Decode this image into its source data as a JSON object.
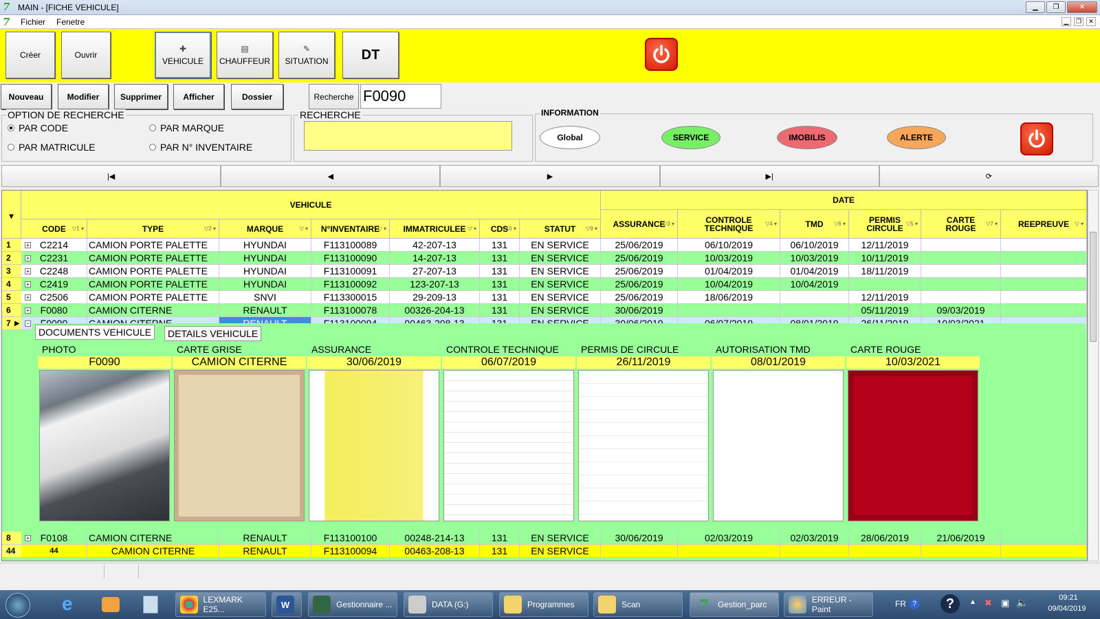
{
  "window": {
    "title": "MAIN - [FICHE VEHICULE]",
    "menu": [
      "Fichier",
      "Fenetre"
    ]
  },
  "toolbar": {
    "creer": "Créer",
    "ouvrir": "Ouvrir",
    "vehicule": "VEHICULE",
    "chauffeur": "CHAUFFEUR",
    "situation": "SITUATION",
    "dt": "DT"
  },
  "actions": {
    "nouveau": "Nouveau",
    "modifier": "Modifier",
    "supprimer": "Supprimer",
    "afficher": "Afficher",
    "dossier": "Dossier",
    "recherche": "Recherche",
    "search_value": "F0090"
  },
  "options": {
    "legend": "OPTION DE RECHERCHE",
    "par_code": "PAR CODE",
    "par_marque": "PAR MARQUE",
    "par_matricule": "PAR MATRICULE",
    "par_inventaire": "PAR N° INVENTAIRE",
    "selected": "PAR CODE"
  },
  "recherche": {
    "legend": "RECHERCHE"
  },
  "information": {
    "legend": "INFORMATION",
    "global": "Global",
    "service": "SERVICE",
    "imobilis": "IMOBILIS",
    "alerte": "ALERTE"
  },
  "colors": {
    "yellow": "#ffff00",
    "grid_green": "#99ff99",
    "header_yellow": "#ffff66",
    "service": "#77ee66",
    "imobilis": "#ee6a73",
    "alerte": "#f7a75a",
    "carte_rouge": "#b5001a"
  },
  "grid": {
    "group_vehicule": "VEHICULE",
    "group_date": "DATE",
    "columns": [
      "CODE",
      "TYPE",
      "MARQUE",
      "N°INVENTAIRE",
      "IMMATRICULEE",
      "CDS",
      "STATUT",
      "ASSURANCE",
      "CONTROLE TECHNIQUE",
      "TMD",
      "PERMIS CIRCULE",
      "CARTE ROUGE",
      "REEPREUVE"
    ],
    "filters": [
      "1",
      "2",
      "",
      "",
      "",
      "10",
      "9",
      "3",
      "4",
      "6",
      "5",
      "7",
      ""
    ],
    "rows": [
      {
        "n": "1",
        "code": "C2214",
        "type": "CAMION PORTE PALETTE",
        "marque": "HYUNDAI",
        "inv": "F113100089",
        "immat": "42-207-13",
        "cds": "131",
        "statut": "EN SERVICE",
        "ass": "25/06/2019",
        "ct": "06/10/2019",
        "tmd": "06/10/2019",
        "permis": "12/11/2019",
        "carte": "",
        "ree": ""
      },
      {
        "n": "2",
        "code": "C2231",
        "type": "CAMION PORTE PALETTE",
        "marque": "HYUNDAI",
        "inv": "F113100090",
        "immat": "14-207-13",
        "cds": "131",
        "statut": "EN SERVICE",
        "ass": "25/06/2019",
        "ct": "10/03/2019",
        "tmd": "10/03/2019",
        "permis": "10/11/2019",
        "carte": "",
        "ree": ""
      },
      {
        "n": "3",
        "code": "C2248",
        "type": "CAMION PORTE PALETTE",
        "marque": "HYUNDAI",
        "inv": "F113100091",
        "immat": "27-207-13",
        "cds": "131",
        "statut": "EN SERVICE",
        "ass": "25/06/2019",
        "ct": "01/04/2019",
        "tmd": "01/04/2019",
        "permis": "18/11/2019",
        "carte": "",
        "ree": ""
      },
      {
        "n": "4",
        "code": "C2419",
        "type": "CAMION PORTE PALETTE",
        "marque": "HYUNDAI",
        "inv": "F113100092",
        "immat": "123-207-13",
        "cds": "131",
        "statut": "EN SERVICE",
        "ass": "25/06/2019",
        "ct": "10/04/2019",
        "tmd": "10/04/2019",
        "permis": "",
        "carte": "",
        "ree": ""
      },
      {
        "n": "5",
        "code": "C2506",
        "type": "CAMION PORTE PALETTE",
        "marque": "SNVI",
        "inv": "F113300015",
        "immat": "29-209-13",
        "cds": "131",
        "statut": "EN SERVICE",
        "ass": "25/06/2019",
        "ct": "18/06/2019",
        "tmd": "",
        "permis": "12/11/2019",
        "carte": "",
        "ree": ""
      },
      {
        "n": "6",
        "code": "F0080",
        "type": "CAMION CITERNE",
        "marque": "RENAULT",
        "inv": "F113100078",
        "immat": "00326-204-13",
        "cds": "131",
        "statut": "EN SERVICE",
        "ass": "30/06/2019",
        "ct": "",
        "tmd": "",
        "permis": "05/11/2019",
        "carte": "09/03/2019",
        "ree": ""
      },
      {
        "n": "7",
        "code": "F0090",
        "type": "CAMION CITERNE",
        "marque": "RENAULT",
        "inv": "F113100094",
        "immat": "00463-208-13",
        "cds": "131",
        "statut": "EN SERVICE",
        "ass": "30/06/2019",
        "ct": "06/07/2019",
        "tmd": "08/01/2019",
        "permis": "26/11/2019",
        "carte": "10/03/2021",
        "ree": ""
      },
      {
        "n": "8",
        "code": "F0108",
        "type": "CAMION CITERNE",
        "marque": "RENAULT",
        "inv": "F113100100",
        "immat": "00248-214-13",
        "cds": "131",
        "statut": "EN SERVICE",
        "ass": "30/06/2019",
        "ct": "02/03/2019",
        "tmd": "02/03/2019",
        "permis": "28/06/2019",
        "carte": "21/06/2019",
        "ree": ""
      }
    ],
    "footer": {
      "n": "44",
      "code": "44",
      "type": "CAMION CITERNE",
      "marque": "RENAULT",
      "inv": "F113100094",
      "immat": "00463-208-13",
      "cds": "131",
      "statut": "EN SERVICE"
    }
  },
  "detail": {
    "tab_docs": "DOCUMENTS VEHICULE",
    "tab_details": "DETAILS VEHICULE",
    "docs": [
      {
        "title": "PHOTO",
        "value": "F0090"
      },
      {
        "title": "CARTE GRISE",
        "value": "CAMION CITERNE"
      },
      {
        "title": "ASSURANCE",
        "value": "30/06/2019"
      },
      {
        "title": "CONTROLE TECHNIQUE",
        "value": "06/07/2019"
      },
      {
        "title": "PERMIS DE CIRCULE",
        "value": "26/11/2019"
      },
      {
        "title": "AUTORISATION  TMD",
        "value": "08/01/2019"
      },
      {
        "title": "CARTE ROUGE",
        "value": "10/03/2021"
      }
    ]
  },
  "taskbar": {
    "items": [
      "LEXMARK E25...",
      "Gestionnaire ...",
      "DATA (G:)",
      "Programmes",
      "Scan",
      "Gestion_parc",
      "ERREUR - Paint"
    ],
    "lang": "FR",
    "time": "09:21",
    "date": "09/04/2019"
  }
}
